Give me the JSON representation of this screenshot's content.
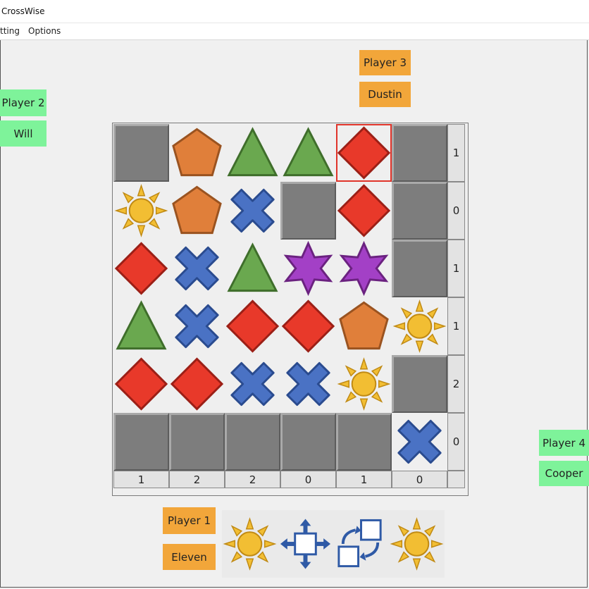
{
  "window": {
    "title": "CrossWise"
  },
  "menu": {
    "items": [
      "tting",
      "Options"
    ]
  },
  "players": {
    "p1": {
      "label": "Player 1",
      "name": "Eleven"
    },
    "p2": {
      "label": "Player 2",
      "name": "Will"
    },
    "p3": {
      "label": "Player 3",
      "name": "Dustin"
    },
    "p4": {
      "label": "Player 4",
      "name": "Cooper"
    }
  },
  "board": {
    "rows": [
      [
        "empty",
        "pentagon",
        "triangle",
        "triangle",
        "diamond",
        "empty"
      ],
      [
        "sun",
        "pentagon",
        "cross",
        "empty",
        "diamond",
        "empty"
      ],
      [
        "diamond",
        "cross",
        "triangle",
        "star",
        "star",
        "empty"
      ],
      [
        "triangle",
        "cross",
        "diamond",
        "diamond",
        "pentagon",
        "sun"
      ],
      [
        "diamond",
        "diamond",
        "cross",
        "cross",
        "sun",
        "empty"
      ],
      [
        "empty",
        "empty",
        "empty",
        "empty",
        "empty",
        "cross"
      ]
    ],
    "selected": {
      "row": 0,
      "col": 4
    },
    "row_scores": [
      "1",
      "0",
      "1",
      "1",
      "2",
      "0"
    ],
    "col_scores": [
      "1",
      "2",
      "2",
      "0",
      "1",
      "0"
    ]
  },
  "hand": [
    "sun",
    "move-tile-icon",
    "swap-tiles-icon",
    "sun"
  ],
  "colors": {
    "pentagon": "#e07f3a",
    "triangle": "#6aa84f",
    "diamond": "#e8392a",
    "cross": "#4a72c4",
    "star": "#a340c6",
    "sun": "#f2be33",
    "empty": "#7d7d7d",
    "selection": "#e0342a",
    "orange_tag": "#f2a63a",
    "green_tag": "#7ef39a"
  }
}
